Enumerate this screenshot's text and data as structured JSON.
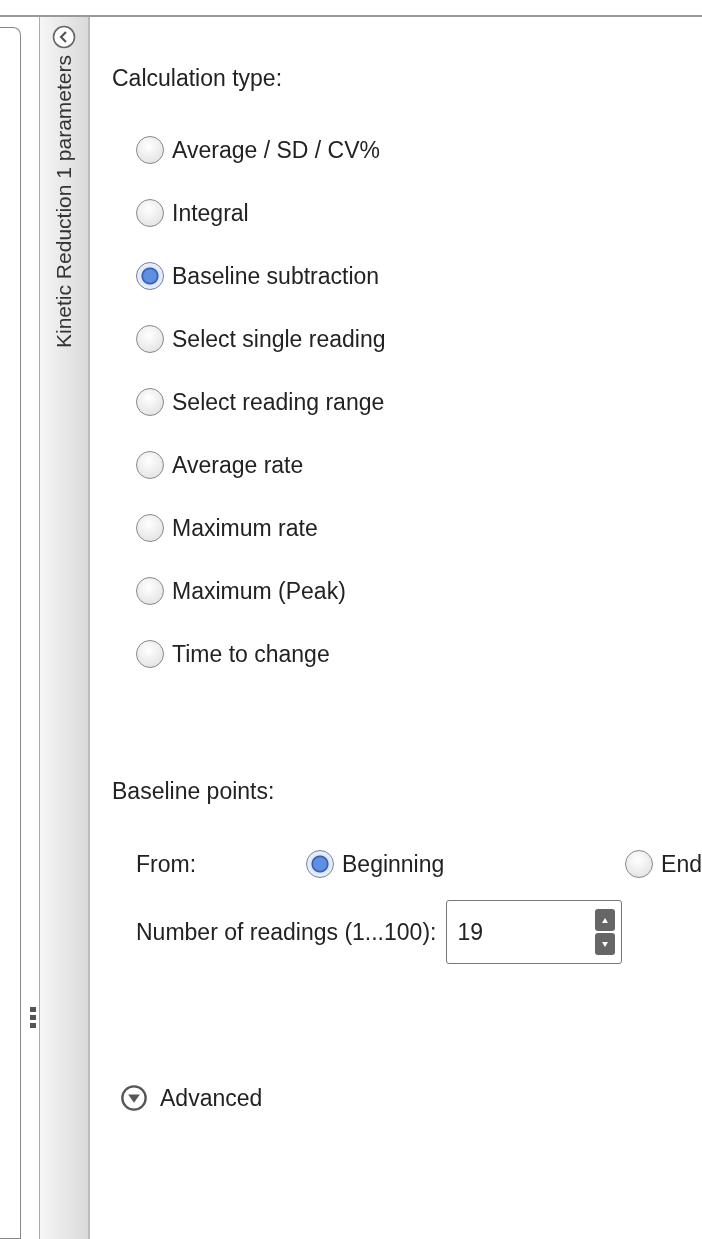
{
  "sidebar": {
    "title": "Kinetic Reduction 1 parameters"
  },
  "calculation_type": {
    "label": "Calculation type:",
    "options": [
      {
        "label": "Average / SD / CV%",
        "selected": false
      },
      {
        "label": "Integral",
        "selected": false
      },
      {
        "label": "Baseline subtraction",
        "selected": true
      },
      {
        "label": "Select single reading",
        "selected": false
      },
      {
        "label": "Select reading range",
        "selected": false
      },
      {
        "label": "Average rate",
        "selected": false
      },
      {
        "label": "Maximum rate",
        "selected": false
      },
      {
        "label": "Maximum (Peak)",
        "selected": false
      },
      {
        "label": "Time to change",
        "selected": false
      }
    ]
  },
  "baseline_points": {
    "label": "Baseline points:",
    "from_label": "From:",
    "from_options": [
      {
        "label": "Beginning",
        "selected": true
      },
      {
        "label": "End",
        "selected": false
      }
    ],
    "readings_label": "Number of readings (1...100):",
    "readings_value": "19"
  },
  "advanced": {
    "label": "Advanced",
    "expanded": false
  }
}
